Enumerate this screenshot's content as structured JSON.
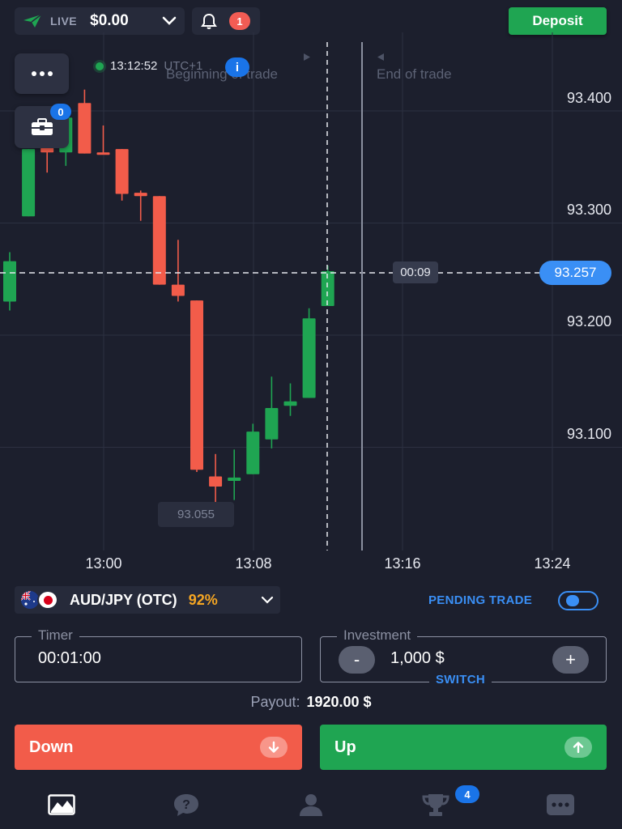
{
  "header": {
    "account_mode": "LIVE",
    "balance": "$0.00",
    "notification_count": "1",
    "deposit_label": "Deposit"
  },
  "chart_overlay": {
    "portfolio_count": "0",
    "server_time": "13:12:52",
    "timezone": "UTC+1",
    "info_label": "i",
    "beginning_label": "Beginning of trade",
    "end_label": "End of trade",
    "countdown": "00:09",
    "current_price": "93.257",
    "low_price": "93.055"
  },
  "chart_data": {
    "type": "candlestick",
    "x_ticks": [
      "13:00",
      "13:08",
      "13:16",
      "13:24"
    ],
    "y_ticks": [
      "93.400",
      "93.300",
      "93.200",
      "93.100"
    ],
    "ylim": [
      93.04,
      93.44
    ],
    "up_color": "#1fa552",
    "down_color": "#f25c4a",
    "candles": [
      {
        "o": 93.23,
        "c": 93.266,
        "h": 93.274,
        "l": 93.222
      },
      {
        "o": 93.306,
        "c": 93.366,
        "h": 93.366,
        "l": 93.306
      },
      {
        "o": 93.367,
        "c": 93.363,
        "h": 93.372,
        "l": 93.345
      },
      {
        "o": 93.363,
        "c": 93.394,
        "h": 93.398,
        "l": 93.351
      },
      {
        "o": 93.407,
        "c": 93.362,
        "h": 93.419,
        "l": 93.362
      },
      {
        "o": 93.363,
        "c": 93.361,
        "h": 93.387,
        "l": 93.361
      },
      {
        "o": 93.366,
        "c": 93.326,
        "h": 93.366,
        "l": 93.32
      },
      {
        "o": 93.327,
        "c": 93.324,
        "h": 93.329,
        "l": 93.302
      },
      {
        "o": 93.324,
        "c": 93.245,
        "h": 93.324,
        "l": 93.245
      },
      {
        "o": 93.245,
        "c": 93.235,
        "h": 93.285,
        "l": 93.23
      },
      {
        "o": 93.231,
        "c": 93.08,
        "h": 93.231,
        "l": 93.078
      },
      {
        "o": 93.074,
        "c": 93.065,
        "h": 93.094,
        "l": 93.05
      },
      {
        "o": 93.07,
        "c": 93.073,
        "h": 93.098,
        "l": 93.053
      },
      {
        "o": 93.076,
        "c": 93.114,
        "h": 93.121,
        "l": 93.076
      },
      {
        "o": 93.107,
        "c": 93.135,
        "h": 93.163,
        "l": 93.099
      },
      {
        "o": 93.137,
        "c": 93.141,
        "h": 93.157,
        "l": 93.128
      },
      {
        "o": 93.144,
        "c": 93.215,
        "h": 93.224,
        "l": 93.144
      },
      {
        "o": 93.226,
        "c": 93.257,
        "h": 93.262,
        "l": 93.226
      }
    ]
  },
  "asset": {
    "name": "AUD/JPY (OTC)",
    "payout_percent": "92%",
    "pending_trade_label": "PENDING TRADE"
  },
  "controls": {
    "timer_label": "Timer",
    "timer_value": "00:01:00",
    "investment_label": "Investment",
    "investment_value": "1,000 $",
    "minus": "-",
    "plus": "+",
    "switch_label": "SWITCH",
    "payout_label": "Payout:",
    "payout_value": "1920.00 $",
    "down_label": "Down",
    "up_label": "Up"
  },
  "bottom_nav": {
    "tournaments_badge": "4",
    "items": [
      "chart-icon",
      "help-icon",
      "profile-icon",
      "trophy-icon",
      "more-icon"
    ]
  }
}
